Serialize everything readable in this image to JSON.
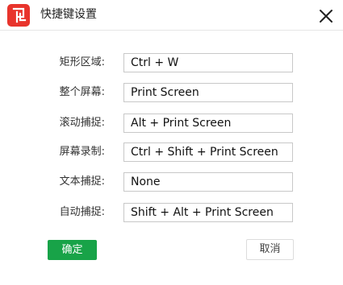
{
  "dialog": {
    "title": "快捷键设置",
    "close_icon": "close-icon",
    "app_icon": "app-logo-icon"
  },
  "shortcuts": [
    {
      "label": "矩形区域:",
      "value": "Ctrl + W"
    },
    {
      "label": "整个屏幕:",
      "value": "Print Screen"
    },
    {
      "label": "滚动捕捉:",
      "value": "Alt + Print Screen"
    },
    {
      "label": "屏幕录制:",
      "value": "Ctrl + Shift + Print Screen"
    },
    {
      "label": "文本捕捉:",
      "value": "None"
    },
    {
      "label": "自动捕捉:",
      "value": "Shift + Alt + Print Screen"
    }
  ],
  "buttons": {
    "confirm_label": "确定",
    "cancel_label": "取消"
  },
  "colors": {
    "brand": "#e8342c",
    "confirm": "#18a348"
  }
}
